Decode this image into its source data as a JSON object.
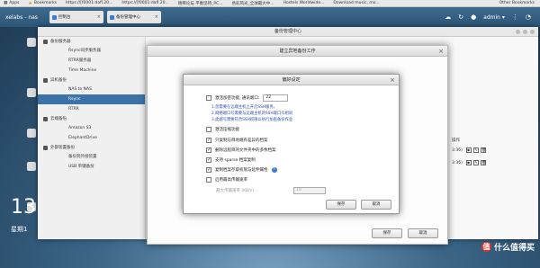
{
  "browser": {
    "bookmarks": [
      {
        "label": "Apps"
      },
      {
        "label": "Bookmarks"
      },
      {
        "label": "https://[f0001:dafl.20..."
      },
      {
        "label": "https://[f0001:dafl.20..."
      },
      {
        "label": "德稀论坛 平衡坚持_PC..."
      },
      {
        "label": "色彩风光_全球最大中..."
      },
      {
        "label": "Hostels Worldwide..."
      },
      {
        "label": "Download music, mo..."
      }
    ],
    "other_bookmarks": "Other Bookmarks"
  },
  "nas": {
    "logo": "xelabs - nas",
    "tabs": [
      {
        "label": "控制台"
      },
      {
        "label": "备份管理中心"
      }
    ],
    "user": "admin ▾"
  },
  "desktop": {
    "clock": "13",
    "date": "星期1"
  },
  "watermark": {
    "text": "什么值得买",
    "mark": "值"
  },
  "outer_window": {
    "title": "备份管理中心",
    "sidebar": {
      "sections": [
        {
          "label": "备份服务器",
          "items": [
            "Rsync同步服务器",
            "RTRR服务器",
            "Time Machine"
          ]
        },
        {
          "label": "异机备份",
          "items": [
            "NAS to NAS",
            "Rsync",
            "RTRR"
          ]
        },
        {
          "label": "云端备份",
          "items": [
            "Amazon S3",
            "ElephantDrive"
          ]
        },
        {
          "label": "外部装置备份",
          "items": [
            "备份到外接装置",
            "USB 单键备份"
          ]
        }
      ],
      "active_item": "Rsync"
    },
    "table": {
      "column_header": "操作",
      "rows": [
        {
          "time": "3:36)"
        },
        {
          "time": "3:36)"
        }
      ]
    }
  },
  "mid_dialog": {
    "title": "建立异地备份工作",
    "buttons": {
      "save": "保存",
      "cancel": "取消"
    }
  },
  "modal": {
    "title": "偏好设定",
    "port_option": {
      "label": "激活加密功能, 通讯端口:",
      "value": "22",
      "checked": false
    },
    "notes": [
      "1.您需要在远端主机上开启SSH服务。",
      "2.网络端口号需要与远端主机的SSH端口号相同",
      "3.此端号需要符合SSH权限以执行加密备份作业"
    ],
    "options": [
      {
        "label": "激活压缩功能",
        "checked": false
      },
      {
        "label": "只复制与目地端有差异的档案",
        "checked": true
      },
      {
        "label": "删除远程目的文件夹中的多余档案",
        "checked": true
      },
      {
        "label": "支持 sparse 档案复制",
        "checked": true
      },
      {
        "label": "复制档案存取权限与延伸属性",
        "checked": true
      },
      {
        "label": "启用最高传输速率",
        "checked": false
      }
    ],
    "rate": {
      "label": "最大传输速率 (KB/s)",
      "value": "10"
    },
    "buttons": {
      "save": "保存",
      "cancel": "取消"
    }
  }
}
